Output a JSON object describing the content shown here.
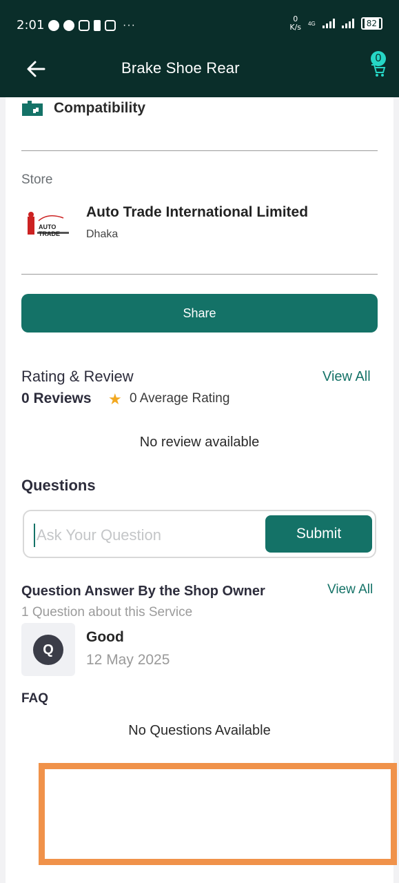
{
  "status_bar": {
    "time": "2:01",
    "speed_value": "0",
    "speed_unit": "K/s",
    "network": "4G",
    "battery": "82"
  },
  "app_bar": {
    "title": "Brake Shoe Rear",
    "cart_count": "0"
  },
  "compatibility": {
    "label": "Compatibility"
  },
  "store": {
    "heading": "Store",
    "logo_text": "AUTO TRADE",
    "name": "Auto Trade International Limited",
    "city": "Dhaka"
  },
  "share": {
    "label": "Share"
  },
  "rating": {
    "title": "Rating & Review",
    "view_all": "View All",
    "reviews_count": "0 Reviews",
    "average": "0 Average Rating",
    "empty": "No review available"
  },
  "questions": {
    "title": "Questions",
    "input_placeholder": "Ask Your Question",
    "submit_label": "Submit"
  },
  "qa": {
    "title": "Question Answer By the Shop Owner",
    "view_all": "View All",
    "subtitle": "1 Question about this Service",
    "items": [
      {
        "avatar_letter": "Q",
        "text": "Good",
        "date": "12 May 2025"
      }
    ]
  },
  "faq": {
    "title": "FAQ",
    "empty": "No Questions Available"
  },
  "colors": {
    "primary": "#147267",
    "header_bg": "#0a2e2a",
    "badge": "#26d6c5",
    "star": "#f2a820",
    "highlight": "#f0924a"
  }
}
